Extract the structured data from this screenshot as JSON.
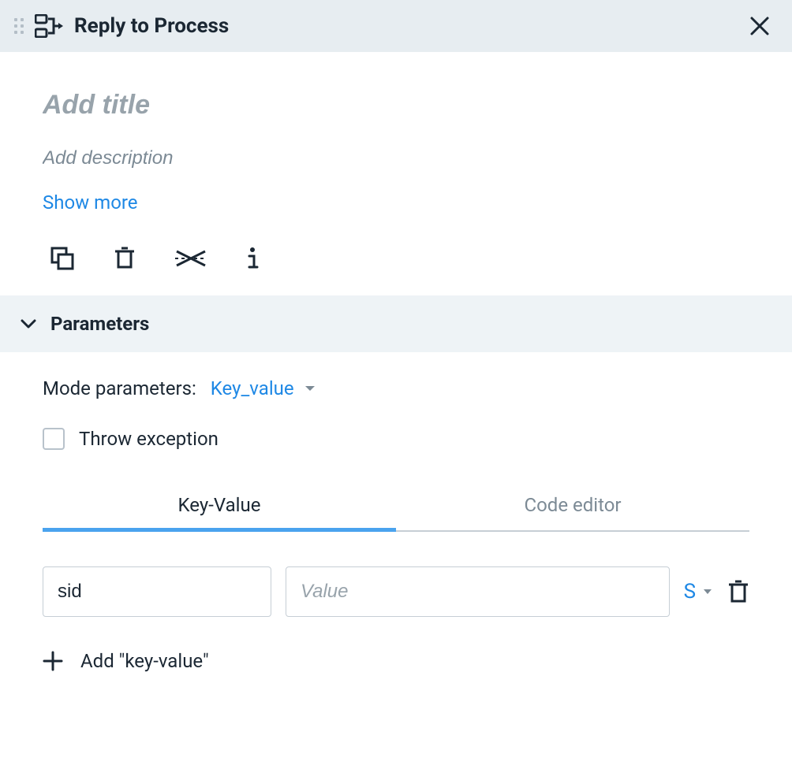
{
  "header": {
    "title": "Reply to Process"
  },
  "form": {
    "title_placeholder": "Add title",
    "title_value": "",
    "description_placeholder": "Add description",
    "description_value": "",
    "show_more": "Show more"
  },
  "sections": {
    "parameters": {
      "label": "Parameters"
    }
  },
  "params": {
    "mode_label": "Mode parameters:",
    "mode_value": "Key_value",
    "throw_exception_label": "Throw exception",
    "throw_exception_checked": false,
    "tabs": [
      {
        "id": "kv",
        "label": "Key-Value",
        "active": true
      },
      {
        "id": "code",
        "label": "Code editor",
        "active": false
      }
    ],
    "kv_rows": [
      {
        "key": "sid",
        "value": "",
        "value_placeholder": "Value",
        "type": "S"
      }
    ],
    "add_kv_label": "Add \"key-value\""
  }
}
